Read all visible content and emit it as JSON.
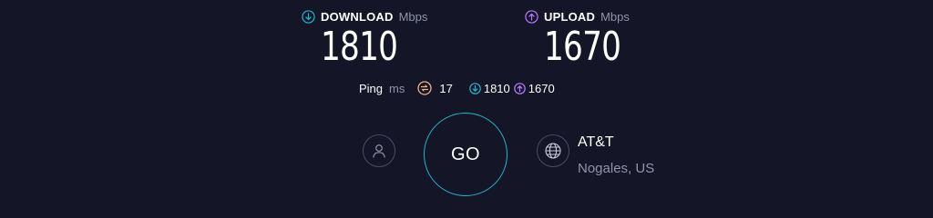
{
  "download": {
    "label": "DOWNLOAD",
    "unit": "Mbps",
    "value": "1810",
    "icon": "arrow-down-circle-icon",
    "color": "#20b7c9"
  },
  "upload": {
    "label": "UPLOAD",
    "unit": "Mbps",
    "value": "1670",
    "icon": "arrow-up-circle-icon",
    "color": "#b57dff"
  },
  "ping": {
    "label": "Ping",
    "unit": "ms",
    "value": "17",
    "icon": "ping-icon",
    "color": "#e8b48a",
    "download_value": "1810",
    "upload_value": "1670"
  },
  "go_button": {
    "label": "GO",
    "color": "#20b7c9"
  },
  "account": {
    "icon": "user-icon"
  },
  "server": {
    "icon": "globe-icon",
    "name": "AT&T",
    "location": "Nogales, US"
  },
  "theme": {
    "background": "#141526",
    "muted_text": "#9193a8"
  }
}
